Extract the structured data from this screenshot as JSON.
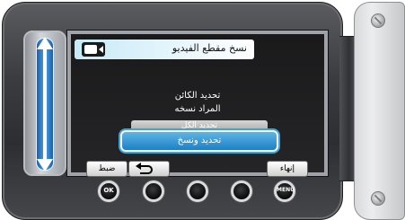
{
  "dialog": {
    "title": "نسخ مقطع الفيديو",
    "message_line1": "تحديد الكائن",
    "message_line2": "المراد نسخه"
  },
  "options": {
    "partially_hidden": "تحديد الكل",
    "selected": "تحديد ونسخ"
  },
  "soft_buttons": {
    "set": "ضبط",
    "quit": "إنهاء"
  },
  "hardware_buttons": {
    "ok": "OK",
    "menu": "MENU"
  }
}
